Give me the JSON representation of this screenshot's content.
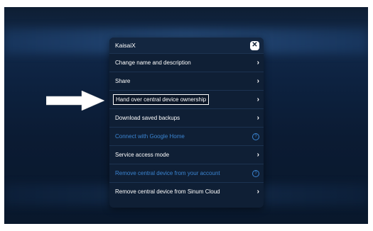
{
  "dialog": {
    "title": "KaisaiX",
    "close_label": "✕",
    "items": [
      {
        "label": "Change name and description",
        "icon": "chevron-right-icon",
        "disabled": false
      },
      {
        "label": "Share",
        "icon": "chevron-right-icon",
        "disabled": false
      },
      {
        "label": "Hand over central device ownership",
        "icon": "chevron-right-icon",
        "disabled": false,
        "highlighted": true
      },
      {
        "label": "Download saved backups",
        "icon": "chevron-right-icon",
        "disabled": false
      },
      {
        "label": "Connect with Google Home",
        "icon": "help-icon",
        "disabled": true
      },
      {
        "label": "Service access mode",
        "icon": "chevron-right-icon",
        "disabled": false
      },
      {
        "label": "Remove central device from your account",
        "icon": "help-icon",
        "disabled": true
      },
      {
        "label": "Remove central device from Sinum Cloud",
        "icon": "chevron-right-icon",
        "disabled": false
      }
    ]
  },
  "glyphs": {
    "chevron": "›",
    "help": "?"
  },
  "colors": {
    "background": "#0e1e33",
    "dialog": "#0f1f35",
    "disabled_text": "#3b84d1",
    "accent": "#ffffff"
  }
}
